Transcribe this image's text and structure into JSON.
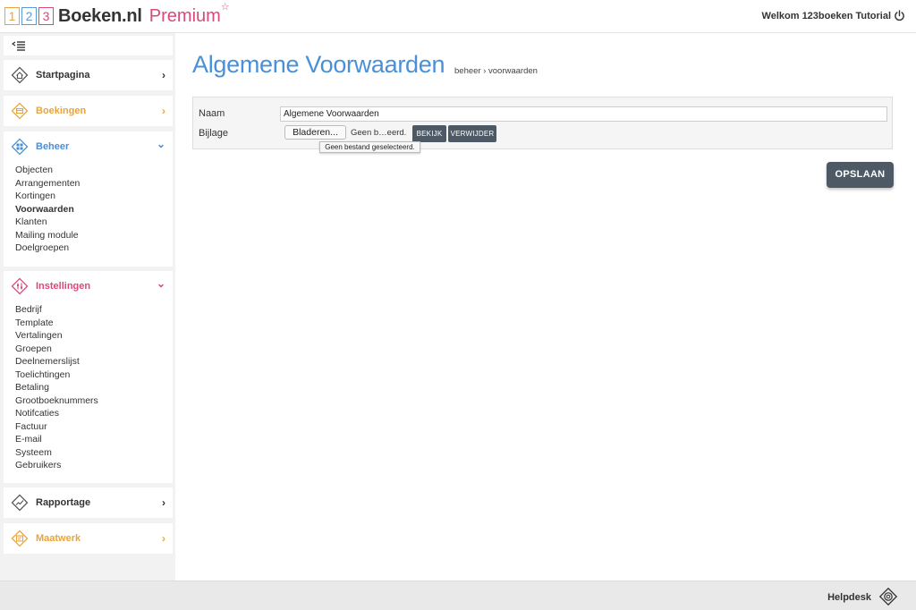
{
  "header": {
    "logo_digits": [
      "1",
      "2",
      "3"
    ],
    "logo_text": "Boeken.nl",
    "logo_premium": "Premium",
    "logo_star": "☆",
    "welcome": "Welkom 123boeken Tutorial"
  },
  "colors": {
    "orange": "#e8a53b",
    "blue": "#4a90d9",
    "pink": "#d9497a",
    "dark": "#4d5a66"
  },
  "sidebar": {
    "sections": [
      {
        "label": "Startpagina",
        "icon": "home-icon",
        "chevron": "›"
      },
      {
        "label": "Boekingen",
        "icon": "bookings-icon",
        "chevron": "›"
      },
      {
        "label": "Beheer",
        "icon": "grid-icon",
        "chevron": "⌄",
        "items": [
          "Objecten",
          "Arrangementen",
          "Kortingen",
          "Voorwaarden",
          "Klanten",
          "Mailing module",
          "Doelgroepen"
        ]
      },
      {
        "label": "Instellingen",
        "icon": "settings-icon",
        "chevron": "⌄",
        "items": [
          "Bedrijf",
          "Template",
          "Vertalingen",
          "Groepen",
          "Deelnemerslijst",
          "Toelichtingen",
          "Betaling",
          "Grootboeknummers",
          "Notifcaties",
          "Factuur",
          "E-mail",
          "Systeem",
          "Gebruikers"
        ]
      },
      {
        "label": "Rapportage",
        "icon": "chart-icon",
        "chevron": "›"
      },
      {
        "label": "Maatwerk",
        "icon": "custom-icon",
        "chevron": "›"
      }
    ]
  },
  "main": {
    "title": "Algemene Voorwaarden",
    "breadcrumb": "beheer › voorwaarden",
    "form": {
      "name_label": "Naam",
      "name_value": "Algemene Voorwaarden",
      "attachment_label": "Bijlage",
      "browse_label": "Bladeren...",
      "file_status": "Geen b…eerd.",
      "view_label": "BEKIJK",
      "delete_label": "VERWIJDER",
      "tooltip": "Geen bestand geselecteerd."
    },
    "save_label": "OPSLAAN"
  },
  "footer": {
    "helpdesk": "Helpdesk"
  }
}
